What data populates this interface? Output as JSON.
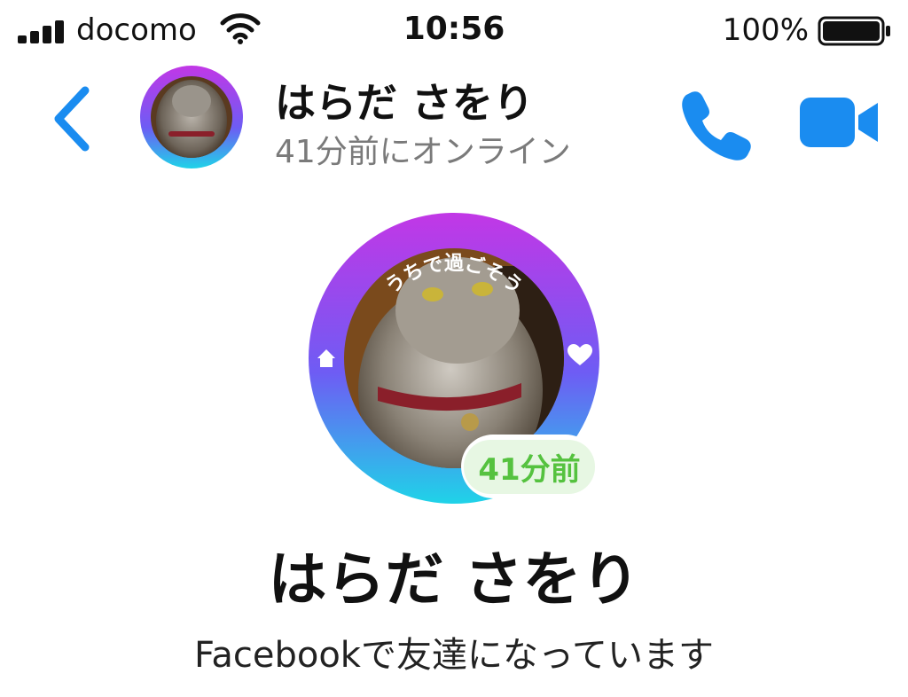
{
  "status_bar": {
    "carrier": "docomo",
    "time": "10:56",
    "battery_percent": "100%",
    "battery_level": 1.0,
    "signal_icon": "signal-bars-icon",
    "wifi_icon": "wifi-icon",
    "battery_icon": "battery-icon"
  },
  "header": {
    "back_icon": "chevron-left-icon",
    "name": "はらだ さをり",
    "status": "41分前にオンライン",
    "call_icon": "phone-icon",
    "video_icon": "video-camera-icon"
  },
  "profile": {
    "frame_text": "うちで過ごそう",
    "active_badge": "41分前",
    "name": "はらだ さをり",
    "subtitle": "Facebookで友達になっています"
  },
  "colors": {
    "accent": "#1a8cf0",
    "active_green": "#55c23f",
    "frame_gradient": [
      "#c237e6",
      "#6e5cf4",
      "#1fd3e8"
    ]
  }
}
